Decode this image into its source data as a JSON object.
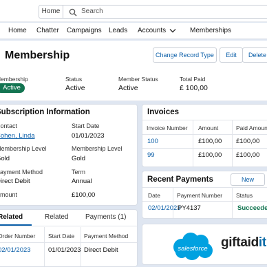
{
  "topbar": {
    "scope_label": "Home",
    "search_placeholder": "Search"
  },
  "nav": {
    "items": [
      "Home",
      "Chatter",
      "Campaigns",
      "Leads",
      "Accounts",
      "Memberships"
    ]
  },
  "record": {
    "title": "Membership",
    "actions": [
      "Change Record Type",
      "Edit",
      "Delete"
    ],
    "highlights": [
      {
        "label": "Membership",
        "value": "Active"
      },
      {
        "label": "Status",
        "value": "Active"
      },
      {
        "label": "Member Status",
        "value": "Active"
      },
      {
        "label": "Total Paid",
        "value": "£ 100,00"
      }
    ]
  },
  "subscription": {
    "title": "Subscription Information",
    "fields": [
      {
        "label": "Contact",
        "value": "Cohen, Linda",
        "link": true
      },
      {
        "label": "Start Date",
        "value": "01/01/2023"
      },
      {
        "label": "Membership Level",
        "value": "Gold"
      },
      {
        "label": "Membership Level",
        "value": "Gold"
      },
      {
        "label": "Payment Method",
        "value": "Direct Debit"
      },
      {
        "label": "Term",
        "value": "Annual"
      },
      {
        "label": "Amount",
        "value": "£100,00"
      }
    ]
  },
  "invoices": {
    "title": "Invoices",
    "columns": [
      "Invoice Number",
      "Amount",
      "Paid Amount"
    ],
    "rows": [
      [
        "100",
        "£100,00",
        "£100,00"
      ],
      [
        "99",
        "£100,00",
        "£100,00"
      ]
    ]
  },
  "related": {
    "tabs": [
      "Related",
      "Related",
      "Payments (1)"
    ],
    "columns": [
      "Order Number",
      "Start Date",
      "Payment Method"
    ],
    "rows": [
      [
        "02/01/2023",
        "01/01/2023",
        "Direct Debit"
      ]
    ]
  },
  "recent_payments": {
    "title": "Recent Payments",
    "new_label": "New",
    "columns": [
      "Date",
      "Payment Number",
      "Status"
    ],
    "rows": [
      [
        "02/01/2023",
        "PY4137",
        "Succeeded"
      ]
    ]
  },
  "logos": {
    "salesforce": "salesforce",
    "giftaid_main": "giftaid",
    "giftaid_suffix": "it"
  },
  "colors": {
    "accent": "#0a5ea8",
    "active_badge": "#137451",
    "succeeded": "#137451",
    "salesforce_cloud": "#00a1e0",
    "page_background": "#dfe6f1"
  }
}
